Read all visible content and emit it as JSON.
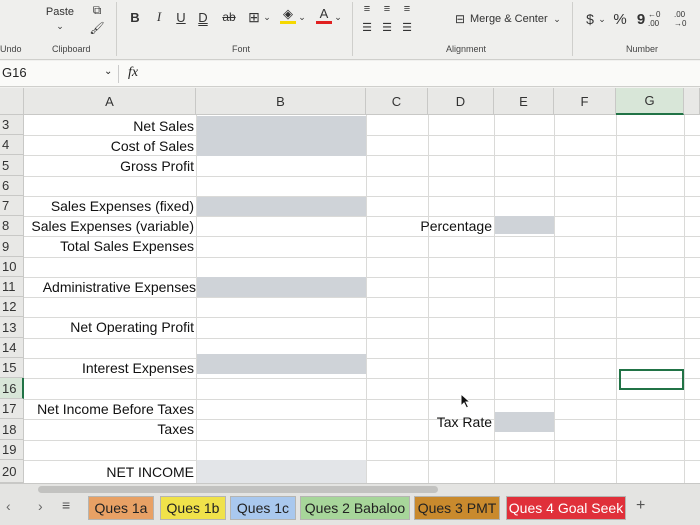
{
  "ribbon": {
    "paste_label": "Paste",
    "bold": "B",
    "italic": "I",
    "underline": "U",
    "strike": "ab",
    "font_color_letter": "A",
    "merge_label": "Merge & Center",
    "currency": "$",
    "percent": "%",
    "comma": "9",
    "inc_decimal": "←0 .00",
    "dec_decimal": ".00 →0",
    "groups": {
      "undo": "Undo",
      "clipboard": "Clipboard",
      "font": "Font",
      "alignment": "Alignment",
      "number": "Number"
    }
  },
  "formula_bar": {
    "name_box": "G16",
    "fx": "fx",
    "value": ""
  },
  "columns": [
    "A",
    "B",
    "C",
    "D",
    "E",
    "F",
    "G"
  ],
  "rows": [
    "3",
    "4",
    "5",
    "6",
    "7",
    "8",
    "9",
    "10",
    "11",
    "12",
    "13",
    "14",
    "15",
    "16",
    "17",
    "18",
    "19",
    "20"
  ],
  "cells": {
    "net_sales": "Net Sales",
    "cost_of_sales": "Cost of Sales",
    "gross_profit": "Gross Profit",
    "sales_exp_fixed": "Sales Expenses (fixed)",
    "sales_exp_variable": "Sales Expenses (variable)",
    "total_sales_exp": "Total Sales Expenses",
    "admin_exp": "Administrative Expenses",
    "net_operating_profit": "Net Operating Profit",
    "interest_exp": "Interest Expenses",
    "net_income_before_taxes": "Net Income Before Taxes",
    "taxes": "Taxes",
    "net_income": "NET INCOME",
    "percentage": "Percentage",
    "tax_rate": "Tax Rate"
  },
  "sheet_tabs": [
    {
      "label": "Ques 1a",
      "color": "#e8a165"
    },
    {
      "label": "Ques 1b",
      "color": "#f0e24a"
    },
    {
      "label": "Ques 1c",
      "color": "#a9c8ee"
    },
    {
      "label": "Ques 2 Babaloo",
      "color": "#a7d69a"
    },
    {
      "label": "Ques 3 PMT",
      "color": "#c98a2d"
    },
    {
      "label": "Ques 4 Goal Seek",
      "color": "#e0303a"
    }
  ],
  "add_sheet": "+"
}
